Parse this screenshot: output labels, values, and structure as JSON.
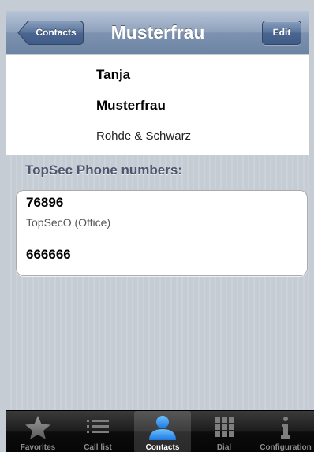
{
  "navbar": {
    "back_label": "Contacts",
    "title": "Musterfrau",
    "edit_label": "Edit"
  },
  "contact": {
    "first_name": "Tanja",
    "last_name": "Musterfrau",
    "company": "Rohde & Schwarz"
  },
  "numbers_section": {
    "title": "TopSec Phone numbers:",
    "rows": [
      {
        "number": "76896",
        "label": "TopSecO (Office)"
      },
      {
        "number": "666666"
      }
    ]
  },
  "tabbar": {
    "tabs": [
      {
        "label": "Favorites",
        "icon": "star-icon",
        "active": false
      },
      {
        "label": "Call list",
        "icon": "list-icon",
        "active": false
      },
      {
        "label": "Contacts",
        "icon": "person-icon",
        "active": true
      },
      {
        "label": "Dial",
        "icon": "keypad-icon",
        "active": false
      },
      {
        "label": "Configuration",
        "icon": "info-icon",
        "active": false
      }
    ]
  },
  "colors": {
    "navbar": "#7d92b0",
    "section_title": "#4c566c",
    "active_icon": "#1e8cf0",
    "tab_inactive": "#8d8d8d"
  }
}
